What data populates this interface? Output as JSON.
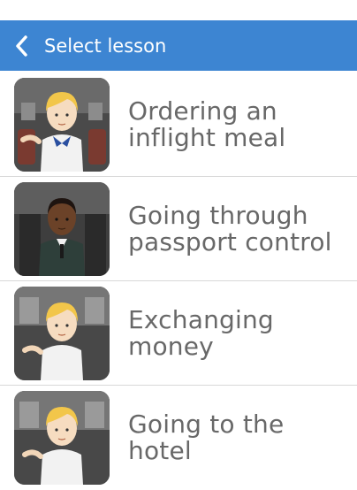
{
  "header": {
    "title": "Select lesson",
    "color": "#3d85d2"
  },
  "lessons": [
    {
      "label": "Ordering an\ninflight meal",
      "character": "blonde-flight-attendant"
    },
    {
      "label": "Going through\npassport control",
      "character": "passport-officer"
    },
    {
      "label": "Exchanging\nmoney",
      "character": "blonde-clerk"
    },
    {
      "label": "Going to the\nhotel",
      "character": "blonde-clerk"
    }
  ]
}
